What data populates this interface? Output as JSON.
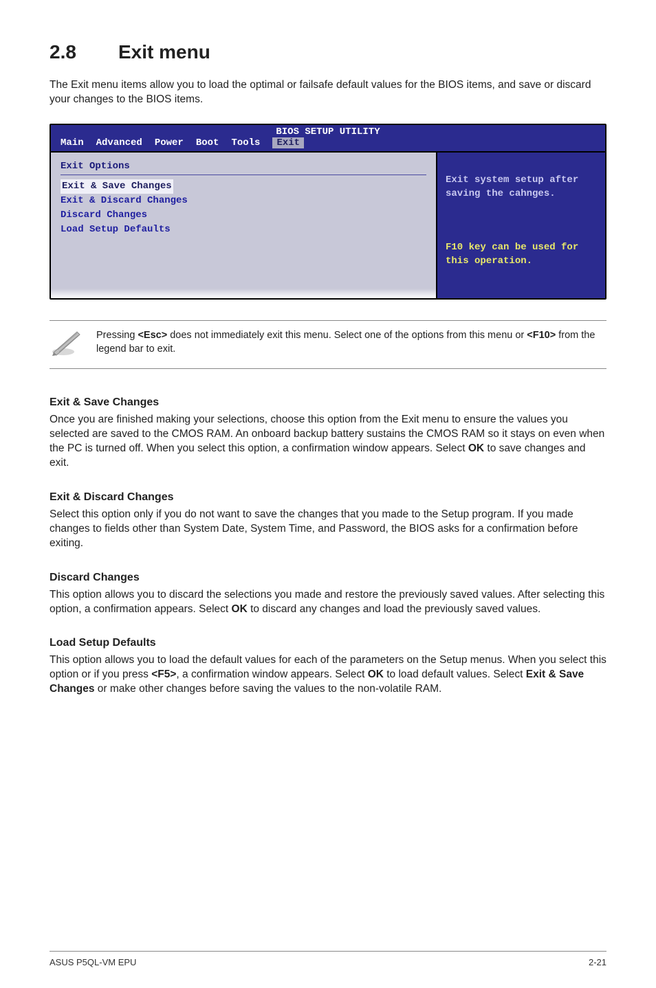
{
  "heading": {
    "num": "2.8",
    "title": "Exit menu"
  },
  "intro": "The Exit menu items allow you to load the optimal or failsafe default values for the BIOS items, and save or discard your changes to the BIOS items.",
  "bios": {
    "header_title": "BIOS SETUP UTILITY",
    "tabs": [
      "Main",
      "Advanced",
      "Power",
      "Boot",
      "Tools",
      "Exit"
    ],
    "left_title": "Exit Options",
    "items": [
      "Exit & Save Changes",
      "Exit & Discard Changes",
      "Discard Changes",
      "",
      "Load Setup Defaults"
    ],
    "help_top": "Exit system setup after saving the cahnges.",
    "help_bottom": "F10 key can be used for this operation."
  },
  "note": {
    "prefix": "Pressing ",
    "key1": "<Esc>",
    "mid": " does not immediately exit this menu. Select one of the options from this menu or ",
    "key2": "<F10>",
    "suffix": " from the legend bar to exit."
  },
  "sections": [
    {
      "title": "Exit & Save Changes",
      "body_parts": [
        "Once you are finished making your selections, choose this option from the Exit menu to ensure the values you selected are saved to the CMOS RAM. An onboard backup battery sustains the CMOS RAM so it stays on even when the PC is turned off. When you select this option, a confirmation window appears. Select ",
        "OK",
        " to save changes and exit."
      ]
    },
    {
      "title": "Exit & Discard Changes",
      "body_parts": [
        "Select this option only if you do not want to save the changes that you made to the Setup program. If you made changes to fields other than System Date, System Time, and Password, the BIOS asks for a confirmation before exiting."
      ]
    },
    {
      "title": "Discard Changes",
      "body_parts": [
        "This option allows you to discard the selections you made and restore the previously saved values. After selecting this option, a confirmation appears. Select ",
        "OK",
        " to discard any changes and load the previously saved values."
      ]
    },
    {
      "title": "Load Setup Defaults",
      "body_parts": [
        "This option allows you to load the default values for each of the parameters on the Setup menus. When you select this option or if you press ",
        "<F5>",
        ", a confirmation window appears. Select ",
        "OK",
        " to load default values. Select ",
        "Exit & Save Changes",
        " or make other changes before saving the values to the non-volatile RAM."
      ]
    }
  ],
  "footer": {
    "left": "ASUS P5QL-VM EPU",
    "right": "2-21"
  }
}
